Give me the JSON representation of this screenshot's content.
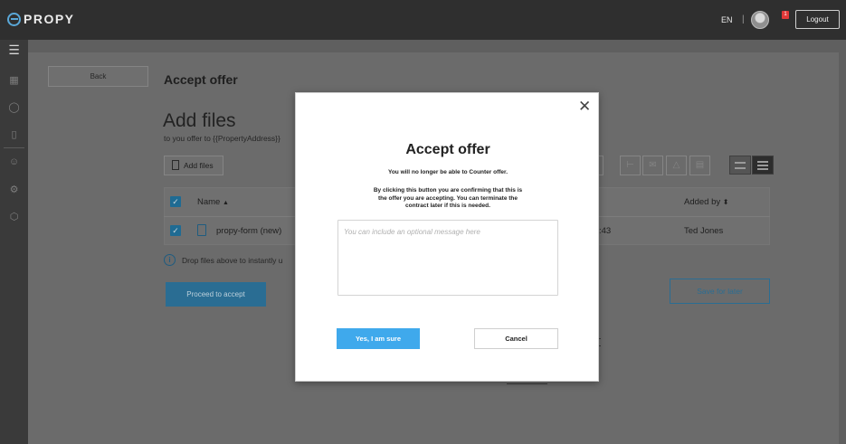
{
  "app": {
    "logo_text": "PROPY"
  },
  "header": {
    "language": "EN",
    "separator": "|",
    "notification_count": "1",
    "logout_label": "Logout"
  },
  "sidebar": {
    "items": [
      {
        "icon": "menu-icon"
      },
      {
        "icon": "grid-icon"
      },
      {
        "icon": "dollar-icon"
      },
      {
        "icon": "document-upload-icon"
      },
      {
        "icon": "user-icon"
      },
      {
        "icon": "gear-icon"
      },
      {
        "icon": "shield-icon"
      }
    ]
  },
  "page": {
    "back_label": "Back",
    "title": "Accept offer",
    "add_files_title": "Add files",
    "subtitle": "to you offer to {{PropertyAddress}}",
    "add_files_label": "Add files",
    "table": {
      "columns": {
        "name": "Name",
        "name_sort": "▲",
        "added_by": "Added by",
        "added_sort": "⬍"
      },
      "rows": [
        {
          "name": "propy-form (new)",
          "time_fragment": ":43",
          "added_by": "Ted Jones"
        }
      ]
    },
    "drop_hint": "Drop files above to instantly u",
    "proceed_label": "Proceed to accept",
    "save_later_label": "Save for later"
  },
  "modal": {
    "close_symbol": "✕",
    "title": "Accept offer",
    "line1": "You will no longer be able to Counter offer.",
    "body": "By clicking this button you are confirming that this is the offer you are accepting. You can terminate the contract later if this is needed.",
    "message_placeholder": "You can include an optional message here",
    "confirm_label": "Yes, I am sure",
    "cancel_label": "Cancel"
  },
  "colors": {
    "accent": "#3fa9ec",
    "topbar": "#2f2f2f",
    "sidebar": "#3a3a3a",
    "overlay_page": "#6b6b6b",
    "notification": "#e03838"
  }
}
